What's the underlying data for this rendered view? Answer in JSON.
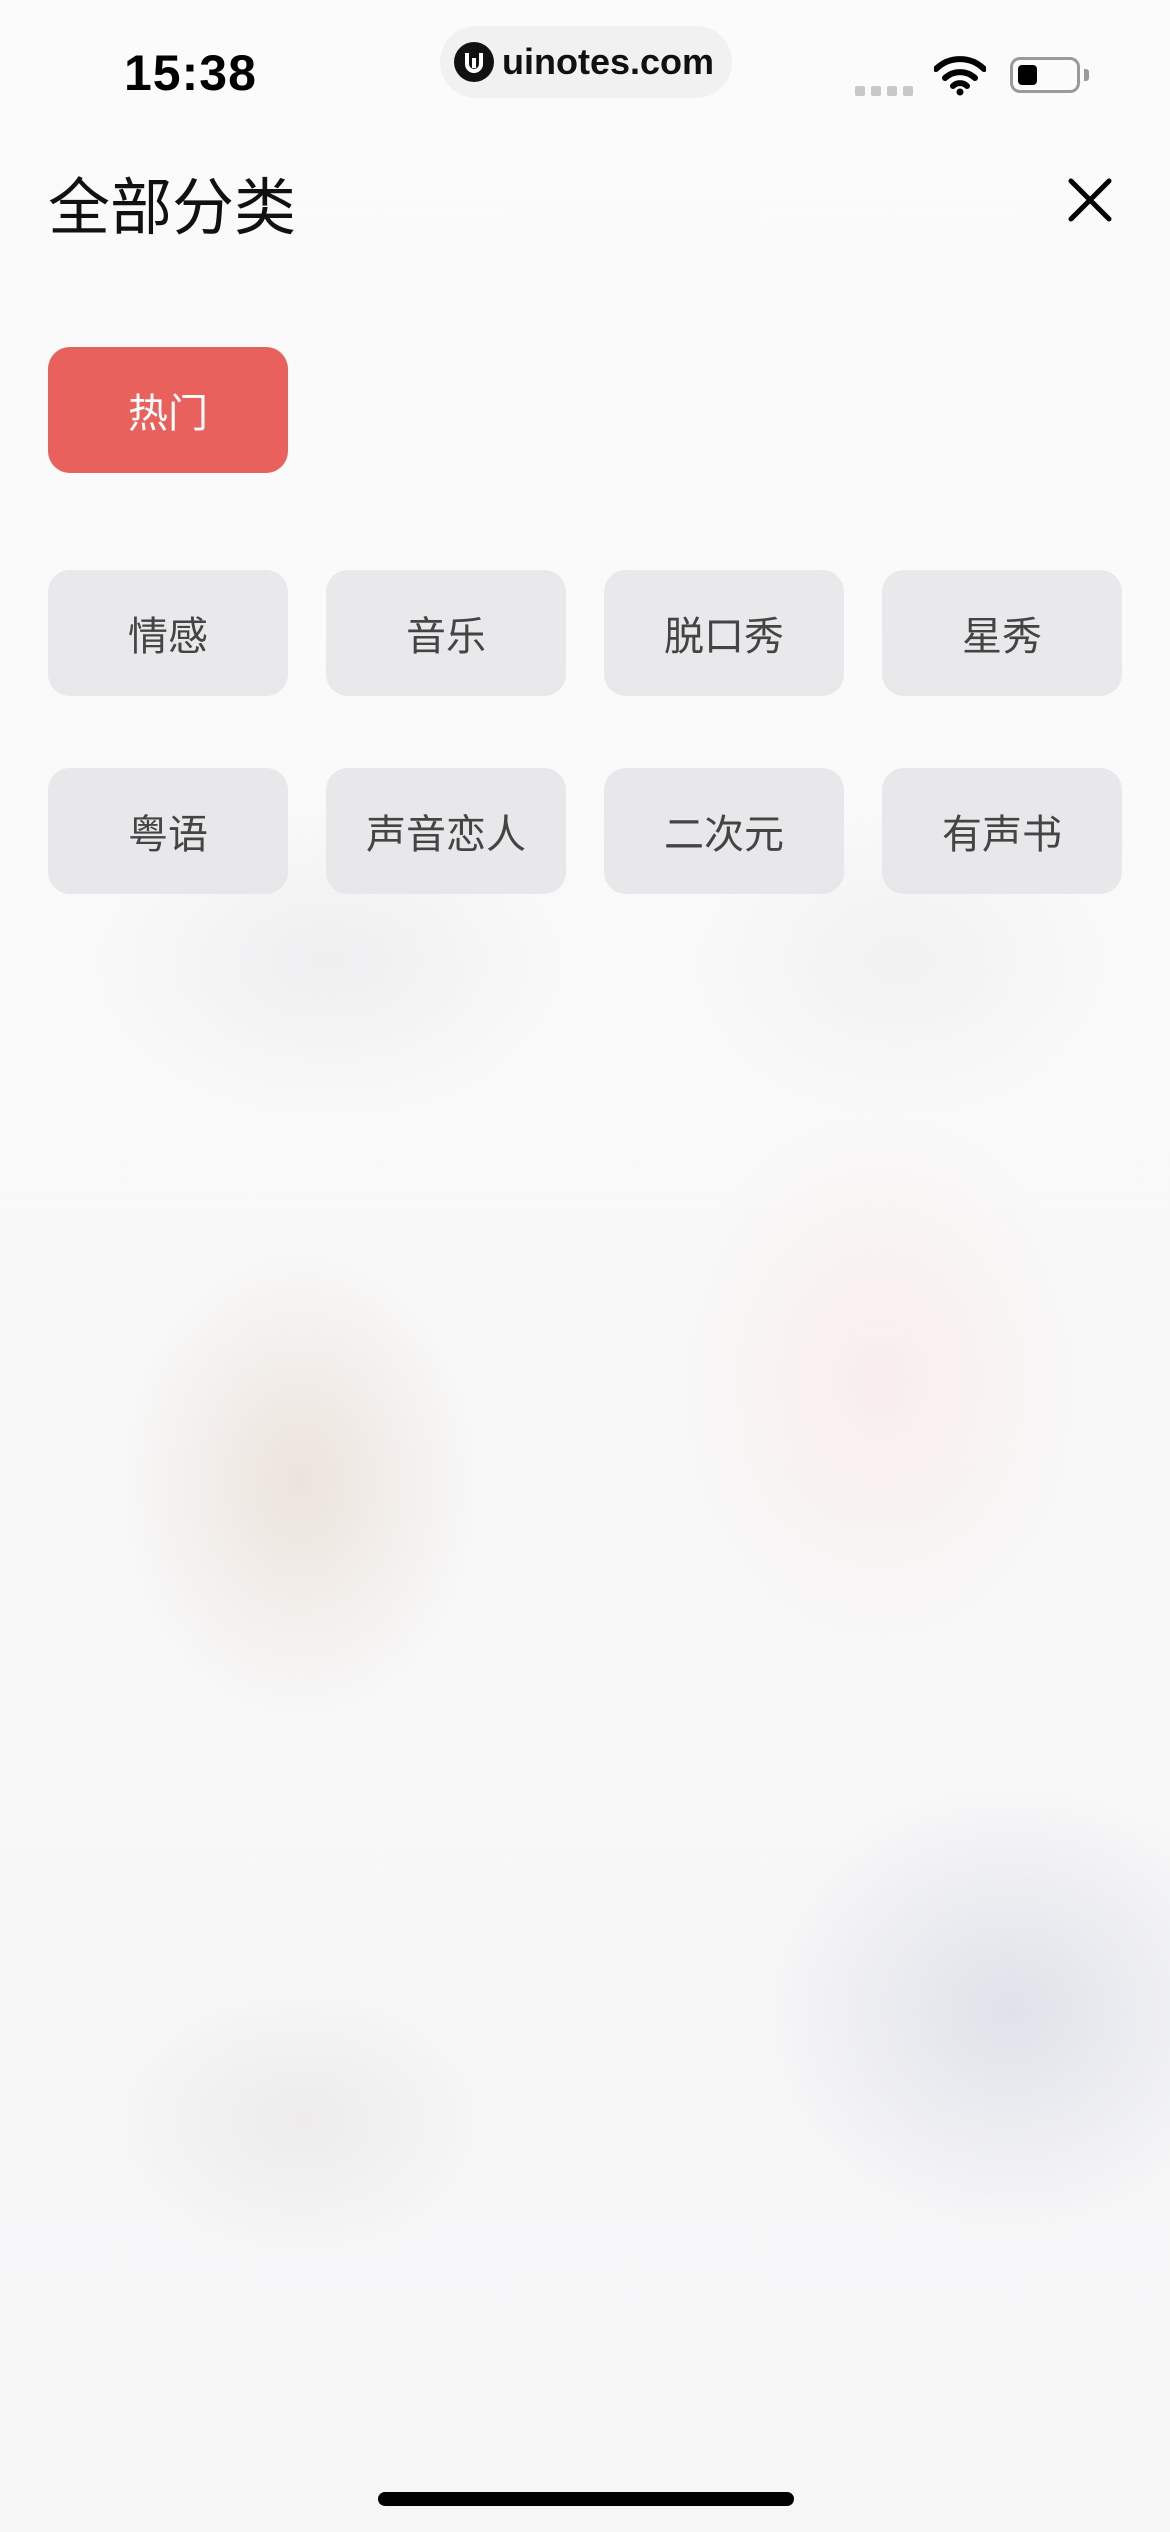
{
  "status_bar": {
    "time": "15:38",
    "url": "uinotes.com",
    "battery_level": 0.35
  },
  "header": {
    "title": "全部分类",
    "close_icon": "close-icon"
  },
  "categories": {
    "hot": "热门",
    "items": [
      "情感",
      "音乐",
      "脱口秀",
      "星秀",
      "粤语",
      "声音恋人",
      "二次元",
      "有声书"
    ]
  },
  "colors": {
    "accent": "#e8615d",
    "chip_bg": "#e2e2e4",
    "chip_text": "#444444"
  }
}
